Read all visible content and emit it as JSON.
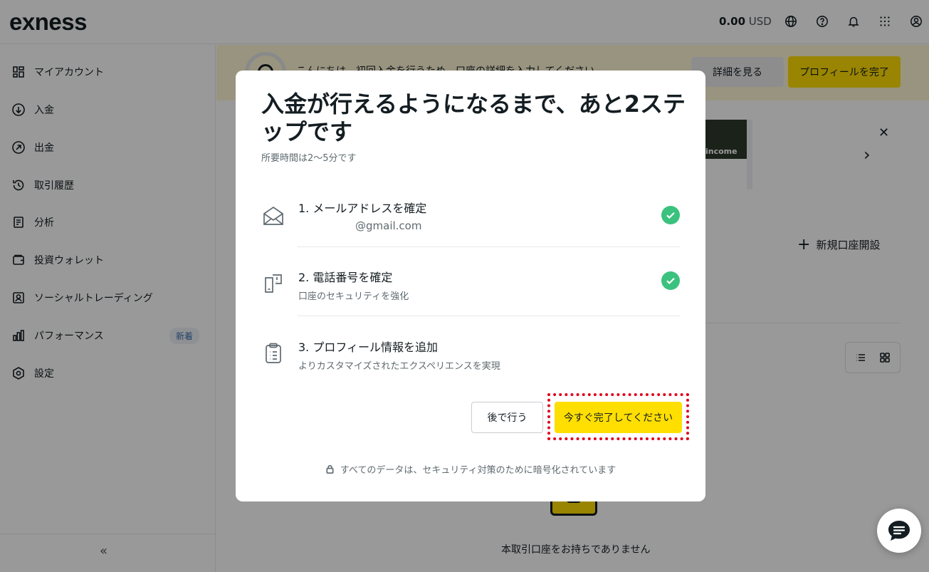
{
  "header": {
    "logo": "exness",
    "balance_amount": "0.00",
    "balance_currency": "USD",
    "icons": [
      "globe-icon",
      "help-icon",
      "bell-icon",
      "apps-grid-icon",
      "user-icon"
    ]
  },
  "sidebar": {
    "items": [
      {
        "label": "マイアカウント",
        "icon": "dashboard-icon"
      },
      {
        "label": "入金",
        "icon": "deposit-icon"
      },
      {
        "label": "出金",
        "icon": "withdraw-icon"
      },
      {
        "label": "取引履歴",
        "icon": "history-icon"
      },
      {
        "label": "分析",
        "icon": "analytics-icon"
      },
      {
        "label": "投資ウォレット",
        "icon": "wallet-icon"
      },
      {
        "label": "ソーシャルトレーディング",
        "icon": "social-trading-icon"
      },
      {
        "label": "パフォーマンス",
        "icon": "performance-icon",
        "badge": "新着"
      },
      {
        "label": "設定",
        "icon": "settings-icon"
      }
    ],
    "collapse_icon": "«"
  },
  "banner": {
    "text": "こんにちは。初回入金を行うため、口座の詳細を入力してください",
    "details_button": "詳細を見る",
    "profile_button": "プロフィールを完了"
  },
  "promo": {
    "image_text": "income"
  },
  "accounts": {
    "new_account_label": "新規口座開設",
    "empty_text": "本取引口座をお持ちでありません"
  },
  "modal": {
    "title": "入金が行えるようになるまで、あと2ステップです",
    "subtitle": "所要時間は2～5分です",
    "steps": [
      {
        "title": "1. メールアドレスを確定",
        "desc": "@gmail.com",
        "done": true,
        "icon": "envelope-icon"
      },
      {
        "title": "2. 電話番号を確定",
        "desc": "口座のセキュリティを強化",
        "done": true,
        "icon": "phone-verify-icon"
      },
      {
        "title": "3. プロフィール情報を追加",
        "desc": "よりカスタマイズされたエクスペリエンスを実現",
        "done": false,
        "icon": "clipboard-icon"
      }
    ],
    "later_button": "後で行う",
    "complete_button": "今すぐ完了してください",
    "security_note": "すべてのデータは、セキュリティ対策のために暗号化されています"
  },
  "colors": {
    "accent": "#ffde02",
    "check": "#3ac27e",
    "highlight": "#e0001b"
  }
}
